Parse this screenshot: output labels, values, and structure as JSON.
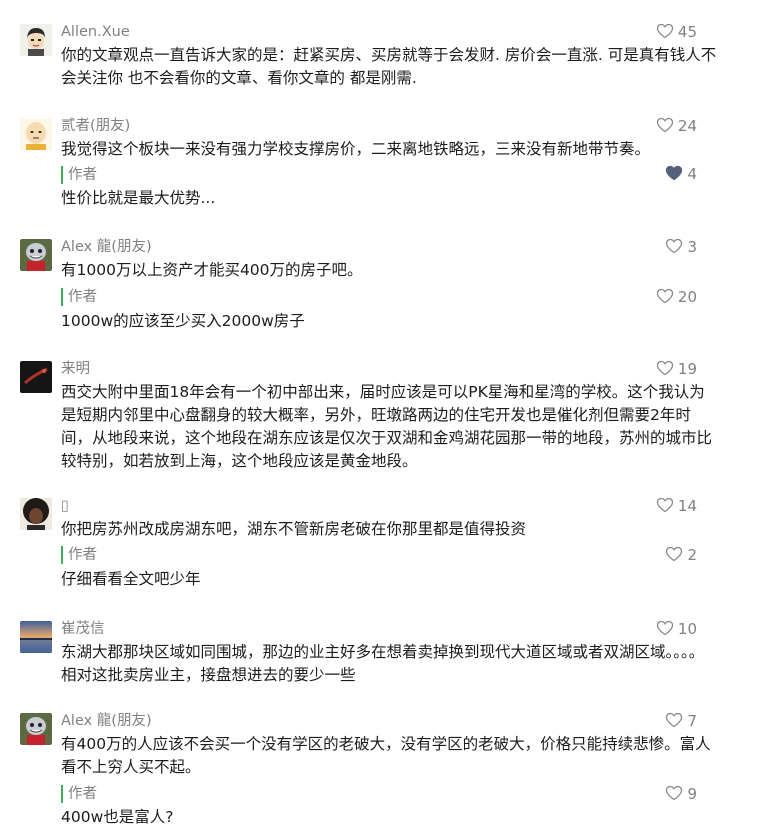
{
  "colors": {
    "author_bar": "#3db15a",
    "meta_text": "#808080",
    "liked_heart": "#55607a"
  },
  "comments": [
    {
      "name": "Allen.Xue",
      "avatar": "cartoon-boy-avatar",
      "likes": "45",
      "text": "你的文章观点一直告诉大家的是：赶紧买房、买房就等于会发财. 房价会一直涨. 可是真有钱人不会关注你 也不会看你的文章、看你文章的 都是刚需."
    },
    {
      "name": "贰者(朋友)",
      "avatar": "bald-cartoon-avatar",
      "likes": "24",
      "text": "我觉得这个板块一来没有强力学校支撑房价，二来离地铁略远，三来没有新地带节奏。",
      "reply": {
        "label": "作者",
        "likes": "4",
        "liked": true,
        "text": "性价比就是最大优势..."
      }
    },
    {
      "name": "Alex 龍(朋友)",
      "avatar": "mascot-avatar",
      "likes": "3",
      "text": "有1000万以上资产才能买400万的房子吧。",
      "reply": {
        "label": "作者",
        "likes": "20",
        "liked": false,
        "text": "1000w的应该至少买入2000w房子"
      }
    },
    {
      "name": "来明",
      "avatar": "dark-photo-avatar",
      "likes": "19",
      "text": "西交大附中里面18年会有一个初中部出来，届时应该是可以PK星海和星湾的学校。这个我认为是短期内邻里中心盘翻身的较大概率，另外，旺墩路两边的住宅开发也是催化剂但需要2年时间，从地段来说，这个地段在湖东应该是仅次于双湖和金鸡湖花园那一带的地段，苏州的城市比较特别，如若放到上海，这个地段应该是黄金地段。"
    },
    {
      "name": "▯",
      "avatar": "curly-hair-avatar",
      "likes": "14",
      "text": "你把房苏州改成房湖东吧，湖东不管新房老破在你那里都是值得投资",
      "reply": {
        "label": "作者",
        "likes": "2",
        "liked": false,
        "text": "仔细看看全文吧少年"
      }
    },
    {
      "name": "崔茂信",
      "avatar": "lake-sunset-avatar",
      "likes": "10",
      "text": "东湖大郡那块区域如同围城，那边的业主好多在想着卖掉换到现代大道区域或者双湖区域。。。。相对这批卖房业主，接盘想进去的要少一些"
    },
    {
      "name": "Alex 龍(朋友)",
      "avatar": "mascot-avatar",
      "likes": "7",
      "text": "有400万的人应该不会买一个没有学区的老破大，没有学区的老破大，价格只能持续悲惨。富人看不上穷人买不起。",
      "reply": {
        "label": "作者",
        "likes": "9",
        "liked": false,
        "text": "400w也是富人?"
      }
    }
  ]
}
